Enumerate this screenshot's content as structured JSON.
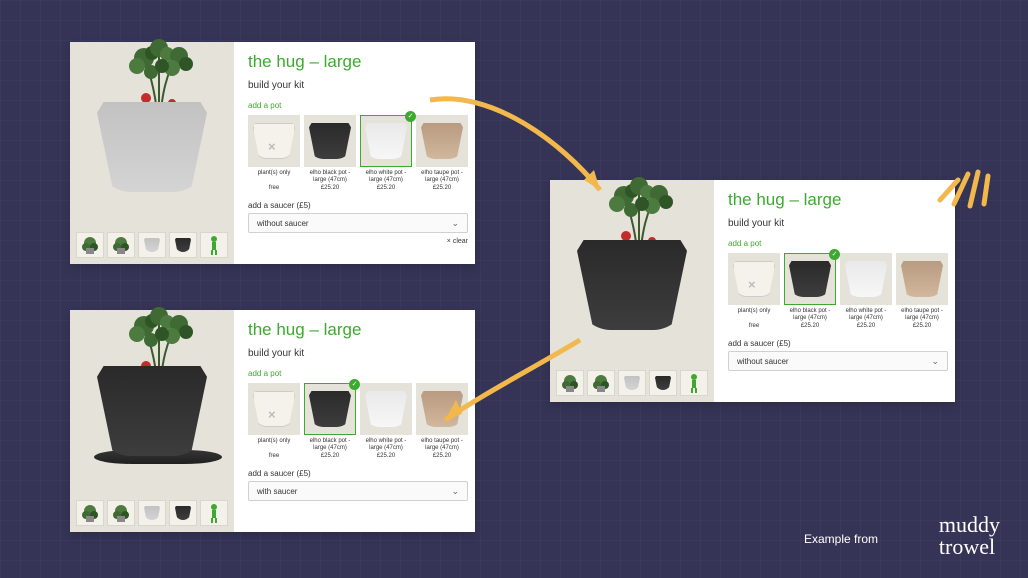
{
  "product": {
    "title": "the hug – large",
    "subtitle": "build your kit",
    "add_pot_label": "add a pot",
    "saucer_label": "add a saucer (£5)",
    "clear_label": "× clear"
  },
  "options": [
    {
      "label": "plant(s) only",
      "price": "free"
    },
    {
      "label": "elho black pot - large (47cm)",
      "price": "£25.20"
    },
    {
      "label": "elho white pot - large (47cm)",
      "price": "£25.20"
    },
    {
      "label": "elho taupe pot - large (47cm)",
      "price": "£25.20"
    }
  ],
  "saucer": {
    "opt_without": "without saucer",
    "opt_with": "with saucer"
  },
  "cards": {
    "c1": {
      "selected": 2,
      "saucer": "without",
      "hero_pot": "grey",
      "show_clear": true,
      "show_saucer_plate": false
    },
    "c2": {
      "selected": 1,
      "saucer": "with",
      "hero_pot": "black",
      "show_clear": false,
      "show_saucer_plate": true
    },
    "c3": {
      "selected": 1,
      "saucer": "without",
      "hero_pot": "black",
      "show_clear": false,
      "show_saucer_plate": false
    }
  },
  "footer": {
    "example_from": "Example from",
    "logo_line1": "muddy",
    "logo_line2": "trowel"
  }
}
